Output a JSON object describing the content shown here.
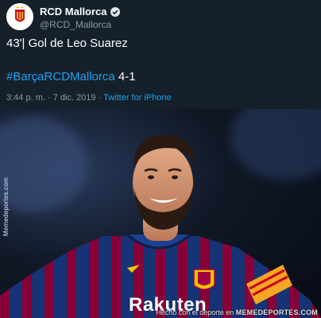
{
  "tweet": {
    "display_name": "RCD Mallorca",
    "handle": "@RCD_Mallorca",
    "text": "43'| Gol de Leo Suarez",
    "hashtag": "#BarçaRCDMallorca",
    "score": "4-1",
    "timestamp": "3:44 p. m. · 7 dic. 2019 · ",
    "source": "Twitter for iPhone",
    "avatar_icon": "rcd-mallorca-crest-icon",
    "verified_icon": "verified-badge-icon"
  },
  "photo": {
    "side_credit": "Memedeportes.com",
    "kit_text": "Rakuten",
    "footer_prefix": "Hecho con el deporte en ",
    "footer_brand": "MEMEDEPORTES.COM"
  },
  "colors": {
    "background": "#15202b",
    "link": "#1da1f2",
    "muted": "#8899a6",
    "kit_blue": "#1c3f8f",
    "kit_red": "#a50044"
  }
}
